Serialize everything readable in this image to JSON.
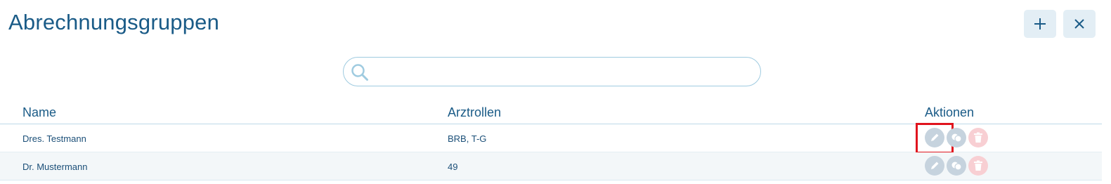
{
  "page": {
    "title": "Abrechnungsgruppen"
  },
  "toolbar": {
    "add_icon": "plus-icon",
    "close_icon": "close-icon"
  },
  "search": {
    "value": "",
    "placeholder": ""
  },
  "table": {
    "columns": [
      "Name",
      "Arztrollen",
      "Aktionen"
    ],
    "rows": [
      {
        "name": "Dres. Testmann",
        "roles": "BRB, T-G"
      },
      {
        "name": "Dr. Mustermann",
        "roles": "49"
      }
    ],
    "action_icons": [
      "pencil-icon",
      "copy-icon",
      "trash-icon"
    ]
  },
  "colors": {
    "title": "#1a5b87",
    "button_bg": "#e3eef5",
    "action_gray": "#c6d3de",
    "action_red": "#f8cfd3",
    "highlight": "#e0141e"
  }
}
